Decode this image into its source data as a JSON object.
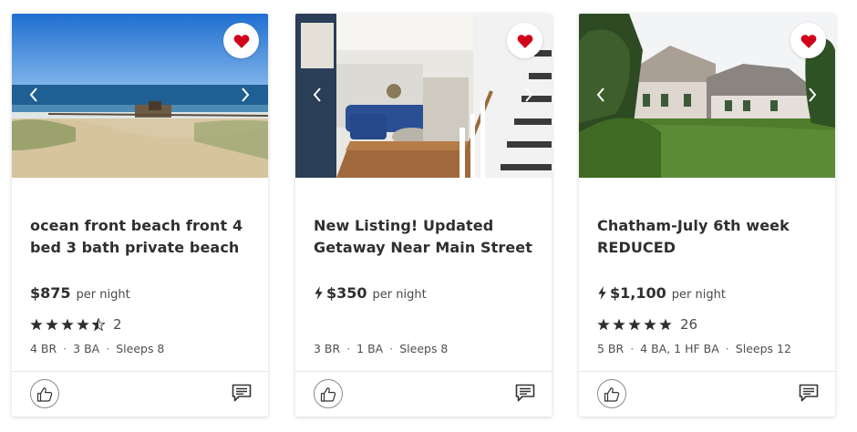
{
  "colors": {
    "heart": "#d0021b",
    "text": "#2f2f2f",
    "muted": "#4f4f4f"
  },
  "cards": [
    {
      "title": "ocean front beach front 4\nbed 3 bath private beach",
      "title_ellipsis": "",
      "instant_book": false,
      "price": "$875",
      "per_night": "per night",
      "rating": 4.5,
      "review_count": "2",
      "facts": [
        "4 BR",
        "3 BA",
        "Sleeps 8"
      ],
      "icons": {
        "favorite": "heart-icon",
        "prev": "chevron-left-icon",
        "next": "chevron-right-icon",
        "like": "thumbs-up-icon",
        "message": "message-icon"
      }
    },
    {
      "title": "New Listing! Updated\nGetaway Near Main Street",
      "title_ellipsis": " -",
      "instant_book": true,
      "price": "$350",
      "per_night": "per night",
      "rating": null,
      "review_count": "",
      "facts": [
        "3 BR",
        "1 BA",
        "Sleeps 8"
      ],
      "icons": {
        "favorite": "heart-icon",
        "prev": "chevron-left-icon",
        "next": "chevron-right-icon",
        "like": "thumbs-up-icon",
        "message": "message-icon"
      }
    },
    {
      "title": "Chatham-July 6th week\nREDUCED",
      "title_ellipsis": "",
      "instant_book": true,
      "price": "$1,100",
      "per_night": "per night",
      "rating": 5,
      "review_count": "26",
      "facts": [
        "5 BR",
        "4 BA, 1 HF BA",
        "Sleeps 12"
      ],
      "icons": {
        "favorite": "heart-icon",
        "prev": "chevron-left-icon",
        "next": "chevron-right-icon",
        "like": "thumbs-up-icon",
        "message": "message-icon"
      }
    }
  ]
}
